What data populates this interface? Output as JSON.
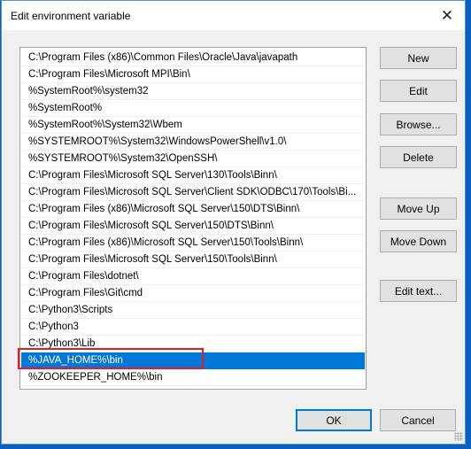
{
  "window": {
    "title": "Edit environment variable",
    "close_icon": "close-icon"
  },
  "list": {
    "selected_index": 17,
    "items": [
      "C:\\Program Files (x86)\\Common Files\\Oracle\\Java\\javapath",
      "C:\\Program Files\\Microsoft MPI\\Bin\\",
      "%SystemRoot%\\system32",
      "%SystemRoot%",
      "%SystemRoot%\\System32\\Wbem",
      "%SYSTEMROOT%\\System32\\WindowsPowerShell\\v1.0\\",
      "%SYSTEMROOT%\\System32\\OpenSSH\\",
      "C:\\Program Files\\Microsoft SQL Server\\130\\Tools\\Binn\\",
      "C:\\Program Files\\Microsoft SQL Server\\Client SDK\\ODBC\\170\\Tools\\Bi...",
      "C:\\Program Files (x86)\\Microsoft SQL Server\\150\\DTS\\Binn\\",
      "C:\\Program Files\\Microsoft SQL Server\\150\\DTS\\Binn\\",
      "C:\\Program Files (x86)\\Microsoft SQL Server\\150\\Tools\\Binn\\",
      "C:\\Program Files\\Microsoft SQL Server\\150\\Tools\\Binn\\",
      "C:\\Program Files\\dotnet\\",
      "C:\\Program Files\\Git\\cmd",
      "C:\\Python3\\Scripts",
      "C:\\Python3",
      "C:\\Python3\\Lib",
      "%JAVA_HOME%\\bin",
      "%ZOOKEEPER_HOME%\\bin"
    ]
  },
  "buttons": {
    "new": "New",
    "edit": "Edit",
    "browse": "Browse...",
    "delete": "Delete",
    "move_up": "Move Up",
    "move_down": "Move Down",
    "edit_text": "Edit text...",
    "ok": "OK",
    "cancel": "Cancel"
  },
  "colors": {
    "selection": "#0078d7",
    "annotation_box": "#e51c23",
    "desktop": "#0b5fbf"
  }
}
